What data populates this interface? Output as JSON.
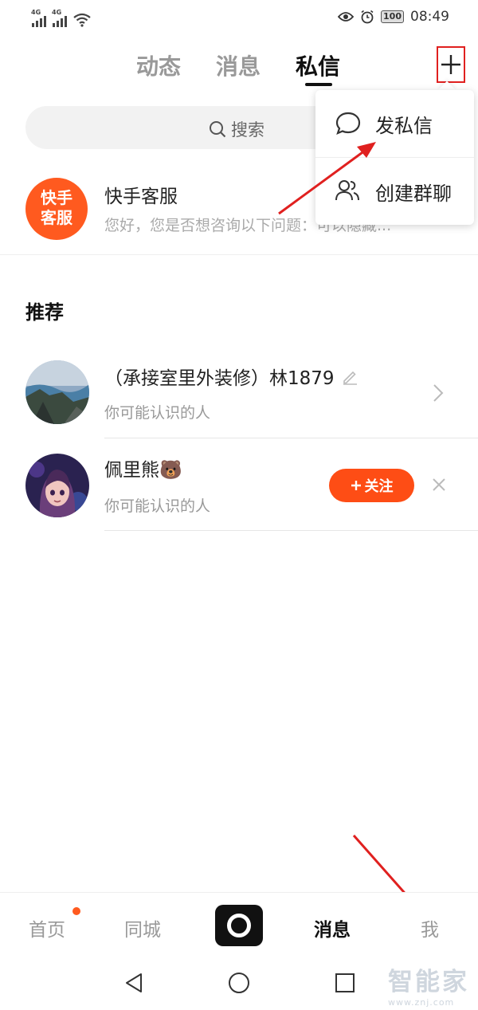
{
  "status_bar": {
    "network_1": "4G",
    "network_2": "4G",
    "battery": "100",
    "time": "08:49"
  },
  "tabs": [
    {
      "label": "动态"
    },
    {
      "label": "消息"
    },
    {
      "label": "私信",
      "active": true
    }
  ],
  "search": {
    "placeholder": "搜索"
  },
  "menu": {
    "items": [
      {
        "label": "发私信",
        "icon": "chat-bubble-icon"
      },
      {
        "label": "创建群聊",
        "icon": "group-users-icon"
      }
    ]
  },
  "conversations": [
    {
      "avatar_text_line1": "快手",
      "avatar_text_line2": "客服",
      "name": "快手客服",
      "preview": "您好，您是否想咨询以下问题：可以隐藏..."
    }
  ],
  "recommend": {
    "title": "推荐",
    "items": [
      {
        "name": "（承接室里外装修）林1879",
        "subtitle": "你可能认识的人",
        "action": "chevron-right"
      },
      {
        "name": "佩里熊🐻",
        "subtitle": "你可能认识的人",
        "follow_label": "关注",
        "action": "follow"
      }
    ]
  },
  "bottom_nav": {
    "items": [
      {
        "label": "首页",
        "badge_dot": true
      },
      {
        "label": "同城"
      },
      {
        "label": "消息",
        "active": true
      },
      {
        "label": "我"
      }
    ]
  },
  "watermark": {
    "text": "智能家",
    "url": "www.znj.com"
  },
  "colors": {
    "accent": "#fe4d15",
    "annotation_red": "#e0201f",
    "text_primary": "#222222",
    "text_secondary": "#999999"
  }
}
